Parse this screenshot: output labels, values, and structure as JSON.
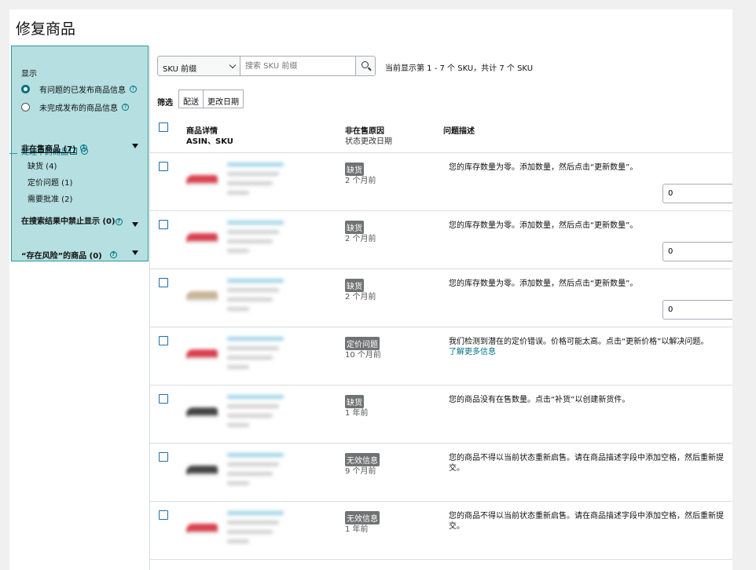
{
  "page": {
    "title": "修复商品"
  },
  "sidebar": {
    "heading": "显示",
    "radios": [
      {
        "label": "有问题的已发布商品信息",
        "selected": true
      },
      {
        "label": "未完成发布的商品信息",
        "selected": false
      }
    ],
    "processing_link": "处理中的商品",
    "groups": {
      "unsellable": {
        "label": "非在售商品 (7)",
        "items": [
          "缺货 (4)",
          "定价问题 (1)",
          "需要批准 (2)"
        ]
      },
      "suppressed": {
        "label": "在搜索结果中禁止显示 (0)"
      },
      "at_risk": {
        "label": "“存在风险”的商品 (0)"
      }
    }
  },
  "toolbar": {
    "select_value": "SKU 前缀",
    "search_placeholder": "搜索 SKU 前缀",
    "count_text": "当前显示第 1 - 7 个 SKU，共计 7 个 SKU",
    "filter_label": "筛选",
    "filter_tabs": [
      "配送",
      "更改日期"
    ]
  },
  "table": {
    "headers": {
      "details": "商品详情",
      "details_sub": "ASIN、SKU",
      "reason": "非在售原因",
      "reason_sub": "状态更改日期",
      "issue": "问题描述"
    },
    "rows": [
      {
        "status": "缺货",
        "time": "2 个月前",
        "desc": "您的库存数量为零。添加数量，然后点击“更新数量”。",
        "link": "",
        "qty": "0",
        "shoe": "#d9414e"
      },
      {
        "status": "缺货",
        "time": "2 个月前",
        "desc": "您的库存数量为零。添加数量，然后点击“更新数量”。",
        "link": "",
        "qty": "0",
        "shoe": "#d9414e"
      },
      {
        "status": "缺货",
        "time": "2 个月前",
        "desc": "您的库存数量为零。添加数量，然后点击“更新数量”。",
        "link": "",
        "qty": "0",
        "shoe": "#c8b49a"
      },
      {
        "status": "定价问题",
        "time": "10 个月前",
        "desc": "我们检测到潜在的定价错误。价格可能太高。点击“更新价格”以解决问题。",
        "link": "了解更多信息",
        "qty": null,
        "shoe": "#d9414e"
      },
      {
        "status": "缺货",
        "time": "1 年前",
        "desc": "您的商品没有在售数量。点击“补货”以创建新货件。",
        "link": "",
        "qty": null,
        "shoe": "#444444"
      },
      {
        "status": "无效信息",
        "time": "9 个月前",
        "desc": "您的商品不得以当前状态重新启售。请在商品描述字段中添加空格，然后重新提交。",
        "link": "",
        "qty": null,
        "shoe": "#444444"
      },
      {
        "status": "无效信息",
        "time": "1 年前",
        "desc": "您的商品不得以当前状态重新启售。请在商品描述字段中添加空格，然后重新提交。",
        "link": "",
        "qty": null,
        "shoe": "#d9414e"
      }
    ]
  },
  "colors": {
    "sidebar_bg": "#b5dfe0",
    "link": "#007185",
    "badge": "#6f7373"
  }
}
